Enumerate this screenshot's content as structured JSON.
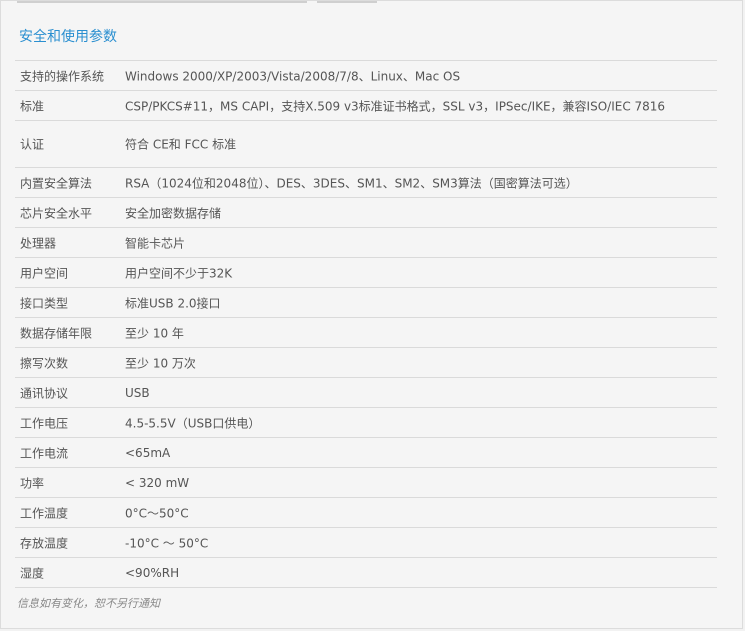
{
  "title": "安全和使用参数",
  "rows": [
    {
      "label": "支持的操作系统",
      "value": "Windows 2000/XP/2003/Vista/2008/7/8、Linux、Mac OS"
    },
    {
      "label": "标准",
      "value": "CSP/PKCS#11，MS CAPI，支持X.509 v3标准证书格式，SSL v3，IPSec/IKE，兼容ISO/IEC 7816"
    },
    {
      "label": "认证",
      "value": "符合 CE和 FCC 标准"
    },
    {
      "label": "内置安全算法",
      "value": "RSA（1024位和2048位）、DES、3DES、SM1、SM2、SM3算法（国密算法可选）"
    },
    {
      "label": "芯片安全水平",
      "value": "安全加密数据存储"
    },
    {
      "label": "处理器",
      "value": "智能卡芯片"
    },
    {
      "label": "用户空间",
      "value": "用户空间不少于32K"
    },
    {
      "label": "接口类型",
      "value": "标准USB 2.0接口"
    },
    {
      "label": "数据存储年限",
      "value": "至少 10 年"
    },
    {
      "label": "擦写次数",
      "value": "至少 10 万次"
    },
    {
      "label": "通讯协议",
      "value": "USB"
    },
    {
      "label": "工作电压",
      "value": "4.5-5.5V（USB口供电）"
    },
    {
      "label": "工作电流",
      "value": "<65mA"
    },
    {
      "label": "功率",
      "value": "< 320 mW"
    },
    {
      "label": "工作温度",
      "value": "0°C～50°C"
    },
    {
      "label": "存放温度",
      "value": "-10°C ～ 50°C"
    },
    {
      "label": "湿度",
      "value": "<90%RH"
    }
  ],
  "note": "信息如有变化，恕不另行通知"
}
